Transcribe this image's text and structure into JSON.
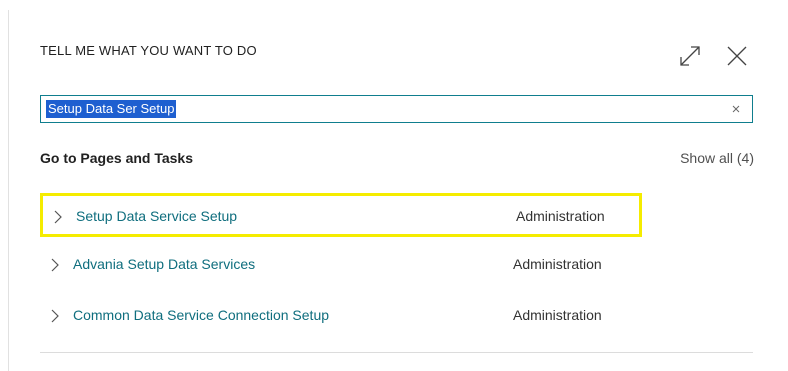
{
  "dialog": {
    "title": "TELL ME WHAT YOU WANT TO DO",
    "expand_icon": "expand-arrows-icon",
    "close_icon": "close-icon"
  },
  "search": {
    "value": "Setup Data Ser Setup",
    "clear_icon": "clear-icon"
  },
  "results": {
    "section_title": "Go to Pages and Tasks",
    "show_all_label": "Show all (4)",
    "items": [
      {
        "name": "Setup Data Service Setup",
        "department": "Administration",
        "highlighted": true
      },
      {
        "name": "Advania Setup Data Services",
        "department": "Administration",
        "highlighted": false
      },
      {
        "name": "Common Data Service Connection Setup",
        "department": "Administration",
        "highlighted": false
      }
    ]
  },
  "colors": {
    "link": "#0f6e7e",
    "search_border": "#0f7e8e",
    "selection": "#1e5fd0",
    "highlight": "#f5ec00"
  }
}
